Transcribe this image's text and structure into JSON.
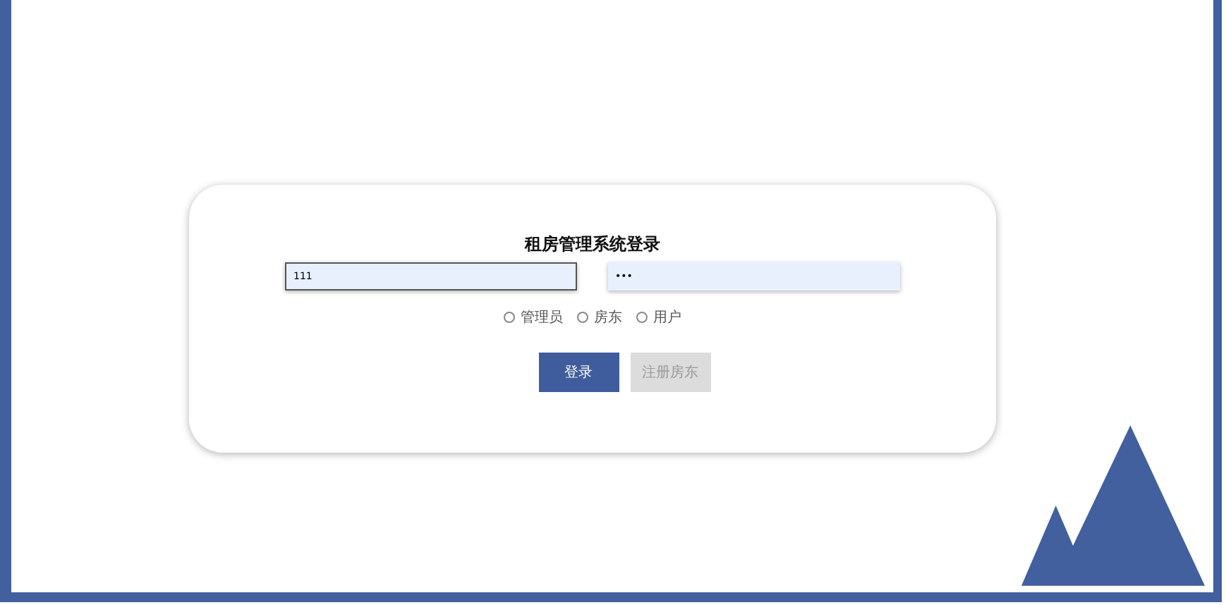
{
  "login": {
    "title": "租房管理系统登录",
    "fields": [
      {
        "value": "111",
        "focused": true
      },
      {
        "value": "•••",
        "focused": false
      }
    ],
    "roles": [
      {
        "label": "管理员",
        "selected": false
      },
      {
        "label": "房东",
        "selected": false
      },
      {
        "label": "用户",
        "selected": false
      }
    ],
    "buttons": [
      {
        "label": "登录",
        "disabled": false
      },
      {
        "label": "注册房东",
        "disabled": true
      }
    ]
  }
}
